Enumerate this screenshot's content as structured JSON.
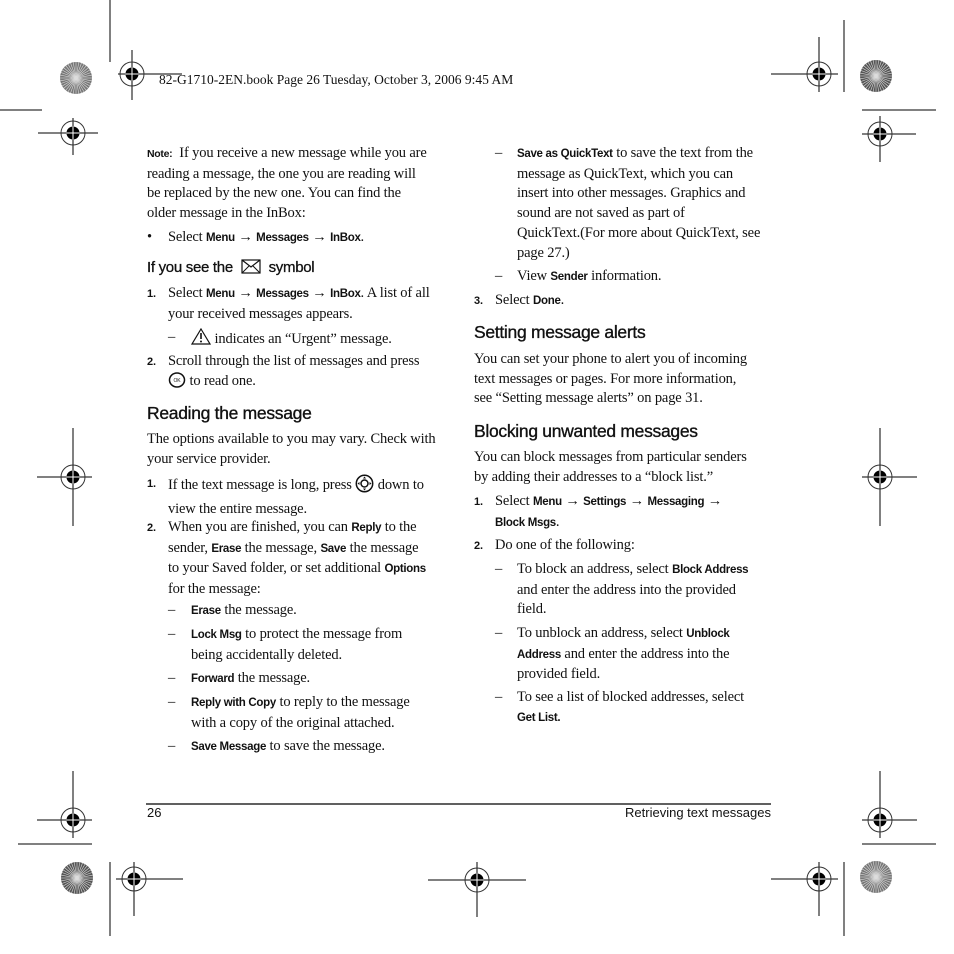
{
  "print_header": "82-G1710-2EN.book  Page 26  Tuesday, October 3, 2006  9:45 AM",
  "left_column": {
    "note": {
      "label": "Note:",
      "lines": [
        "If you receive a new message while you are",
        "reading a message, the one you are reading will",
        "be replaced by the new one. You can find the",
        "older message in the InBox:"
      ]
    },
    "bullet": {
      "symbol": "•",
      "prefix": "Select",
      "path": [
        "Menu",
        "Messages",
        "InBox"
      ],
      "arrow": "→",
      "suffix": "."
    },
    "envelope_section": {
      "heading_before": "If you see the",
      "icon": "envelope-icon",
      "heading_after": "symbol",
      "steps": [
        {
          "num": "1.",
          "prefix": "Select",
          "path": [
            "Menu",
            "Messages",
            "InBox"
          ],
          "line1_suffix": ". A list of all",
          "line2": "your received messages appears.",
          "sub": {
            "dash": "–",
            "icon": "warning-icon",
            "text": "indicates an “Urgent” message."
          }
        },
        {
          "num": "2.",
          "line1": "Scroll through the list of messages and press",
          "icon": "ok-key-icon",
          "line2": "to read one."
        }
      ]
    },
    "reading_section": {
      "heading": "Reading the message",
      "intro": [
        "The options available to you may vary. Check with",
        "your service provider."
      ],
      "step1": {
        "num": "1.",
        "before": "If the text message is long, press",
        "icon": "navigation-key-icon",
        "after": "down to",
        "line2": "view the entire message."
      },
      "step2": {
        "num": "2.",
        "l1_a": "When you are finished, you can",
        "l1_b": "Reply",
        "l1_c": "to the",
        "l2_a": "sender,",
        "l2_b": "Erase",
        "l2_c": "the message,",
        "l2_d": "Save",
        "l2_e": "the message",
        "l3_a": "to your Saved folder, or set additional",
        "l3_b": "Options",
        "l4": "for the message:"
      },
      "options": [
        {
          "dash": "–",
          "bold": "Erase",
          "text": "the message.",
          "line2": ""
        },
        {
          "dash": "–",
          "bold": "Lock Msg",
          "text": "to protect the message from",
          "line2": "being accidentally deleted."
        },
        {
          "dash": "–",
          "bold": "Forward",
          "text": "the message.",
          "line2": ""
        },
        {
          "dash": "–",
          "bold": "Reply with Copy",
          "text": "to reply to the message",
          "line2": "with a copy of the original attached."
        },
        {
          "dash": "–",
          "bold": "Save Message",
          "text": "to save the message.",
          "line2": ""
        }
      ]
    }
  },
  "right_column": {
    "quicktext": {
      "dash": "–",
      "bold": "Save as QuickText",
      "line1": "to save the text from the",
      "lines": [
        "message as QuickText, which you can",
        "insert into other messages. Graphics and",
        "sound are not saved as part of",
        "QuickText.(For more about QuickText, see",
        "page 27.)"
      ]
    },
    "sender": {
      "dash": "–",
      "prefix": "View",
      "bold": "Sender",
      "suffix": "information."
    },
    "step3": {
      "num": "3.",
      "prefix": "Select",
      "bold": "Done",
      "suffix": "."
    },
    "alerts_section": {
      "heading": "Setting message alerts",
      "lines": [
        "You can set your phone to alert you of incoming",
        "text messages or pages. For more information,",
        "see “Setting message alerts” on page 31."
      ]
    },
    "blocking_section": {
      "heading": "Blocking unwanted messages",
      "intro": [
        "You can block messages from particular senders",
        "by adding their addresses to a “block list.”"
      ],
      "step1": {
        "num": "1.",
        "prefix": "Select",
        "path": [
          "Menu",
          "Settings",
          "Messaging"
        ],
        "arrow": "→",
        "line2": "Block Msgs",
        "suffix": "."
      },
      "step2": {
        "num": "2.",
        "text": "Do one of the following:"
      },
      "options": [
        {
          "dash": "–",
          "l1": "To block an address, select",
          "l1_bold": "Block Address",
          "l2": "and enter the address into the provided",
          "l3": "field."
        },
        {
          "dash": "–",
          "l1": "To unblock an address, select",
          "l1_bold": "Unblock",
          "l2_bold": "Address",
          "l2": "and enter the address into the",
          "l3": "provided field."
        },
        {
          "dash": "–",
          "l1": "To see a list of blocked addresses, select",
          "l2_bold": "Get List."
        }
      ]
    }
  },
  "footer": {
    "page_number": "26",
    "section_title": "Retrieving text messages"
  }
}
